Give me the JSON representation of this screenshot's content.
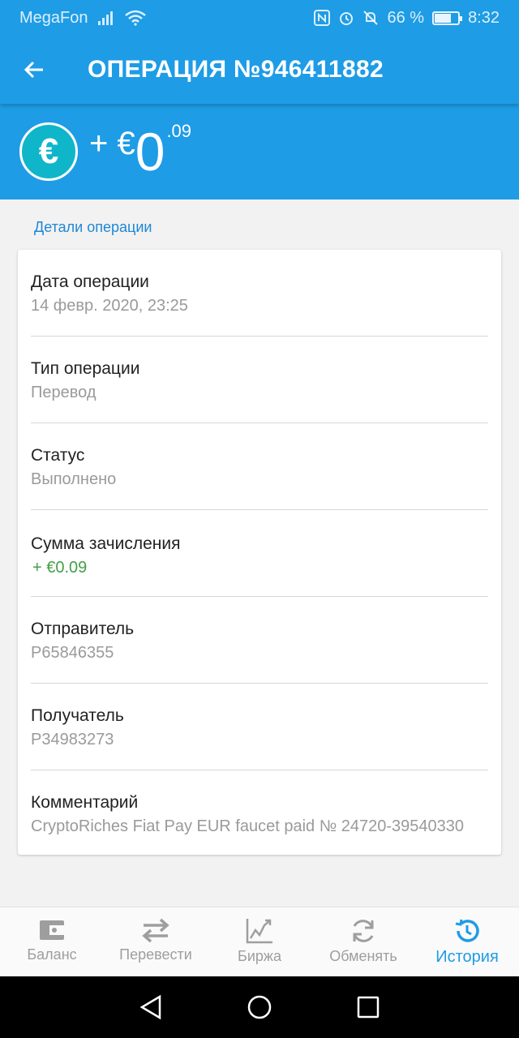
{
  "status_bar": {
    "carrier": "MegaFon",
    "battery_percent": "66 %",
    "battery_level": 0.66,
    "time": "8:32",
    "icons": [
      "signal-icon",
      "wifi-icon",
      "nfc-icon",
      "alarm-icon",
      "mute-icon",
      "battery-icon"
    ]
  },
  "app_bar": {
    "title": "ОПЕРАЦИЯ №946411882",
    "back_icon": "arrow-left-icon"
  },
  "amount": {
    "sign": "+ €",
    "whole": "0",
    "fraction": ".09",
    "currency_icon": "euro-icon"
  },
  "details": {
    "section_title": "Детали операции",
    "rows": [
      {
        "label": "Дата операции",
        "value": "14 февр. 2020, 23:25"
      },
      {
        "label": "Тип операции",
        "value": "Перевод"
      },
      {
        "label": "Статус",
        "value": "Выполнено"
      },
      {
        "label": "Сумма зачисления",
        "value": "+ €0.09"
      },
      {
        "label": "Отправитель",
        "value": "P65846355"
      },
      {
        "label": "Получатель",
        "value": "P34983273"
      },
      {
        "label": "Комментарий",
        "value": "CryptoRiches Fiat Pay EUR faucet paid № 24720-39540330"
      }
    ]
  },
  "bottom_nav": {
    "items": [
      {
        "label": "Баланс",
        "icon": "wallet-icon"
      },
      {
        "label": "Перевести",
        "icon": "transfer-arrows-icon"
      },
      {
        "label": "Биржа",
        "icon": "chart-icon"
      },
      {
        "label": "Обменять",
        "icon": "exchange-icon"
      },
      {
        "label": "История",
        "icon": "history-icon"
      }
    ],
    "active_index": 4
  },
  "colors": {
    "primary": "#1e9ce6",
    "accent_green": "#43a047",
    "coin": "#0fb6c9"
  }
}
